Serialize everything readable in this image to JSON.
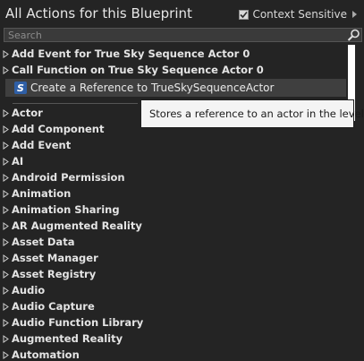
{
  "header": {
    "title": "All Actions for this Blueprint",
    "context_sensitive_label": "Context Sensitive",
    "context_sensitive_checked": true
  },
  "search": {
    "placeholder": "Search",
    "value": ""
  },
  "top_items": [
    "Add Event for True Sky Sequence Actor 0",
    "Call Function on True Sky Sequence Actor 0"
  ],
  "selected_item": {
    "icon_letter": "S",
    "label": "Create a Reference to TrueSkySequenceActor"
  },
  "tooltip": {
    "text": "Stores a reference to an actor in the level"
  },
  "categories": [
    "Actor",
    "Add Component",
    "Add Event",
    "AI",
    "Android Permission",
    "Animation",
    "Animation Sharing",
    "AR Augmented Reality",
    "Asset Data",
    "Asset Manager",
    "Asset Registry",
    "Audio",
    "Audio Capture",
    "Audio Function Library",
    "Augmented Reality",
    "Automation"
  ]
}
